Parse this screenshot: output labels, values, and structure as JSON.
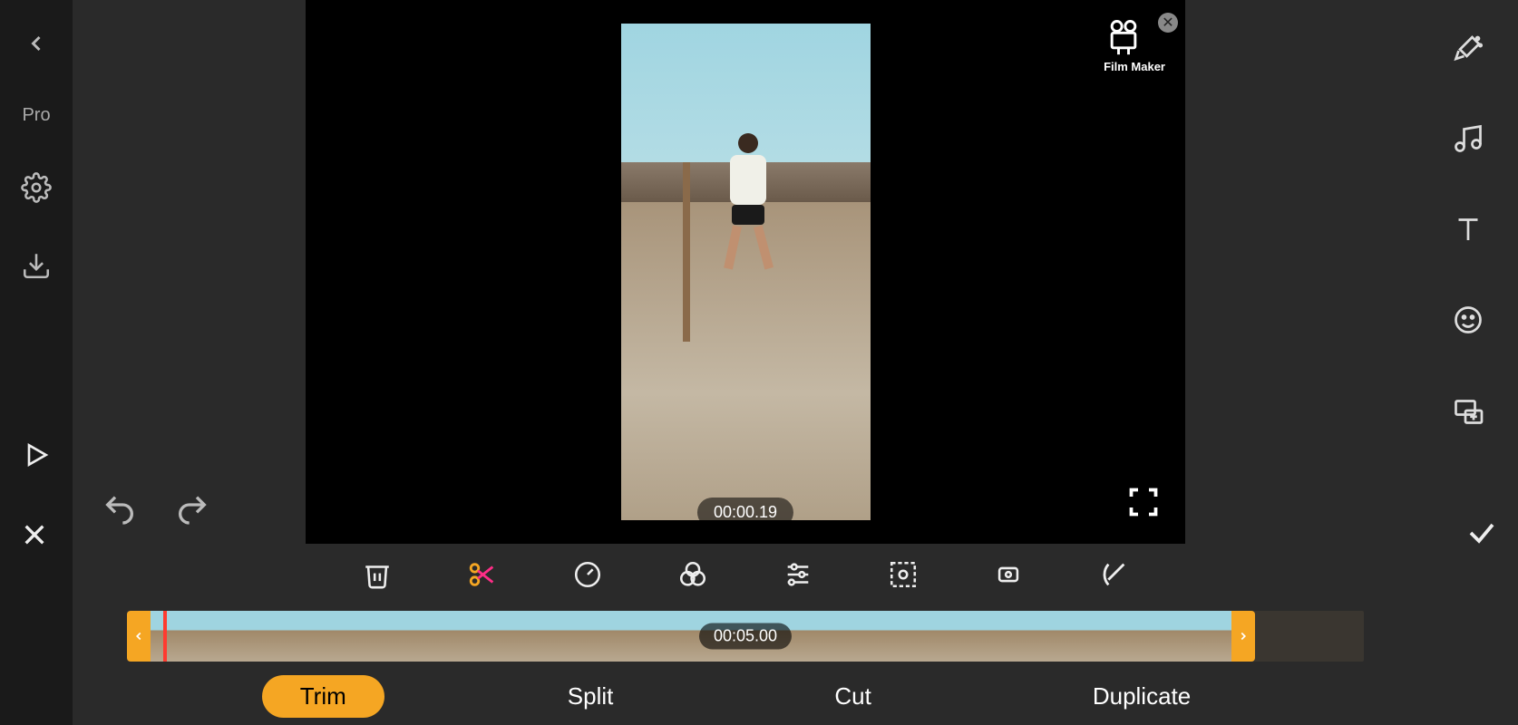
{
  "left_sidebar": {
    "pro_label": "Pro"
  },
  "preview": {
    "watermark_label": "Film Maker",
    "current_time": "00:00.19"
  },
  "timeline": {
    "duration": "00:05.00"
  },
  "tools": {
    "icons": [
      "delete",
      "scissors",
      "speed",
      "filter",
      "adjust",
      "crop-focus",
      "rotate-canvas",
      "flip"
    ]
  },
  "actions": {
    "trim": "Trim",
    "split": "Split",
    "cut": "Cut",
    "duplicate": "Duplicate",
    "active": "trim"
  },
  "right_sidebar": {
    "icons": [
      "effects",
      "music",
      "text",
      "sticker",
      "pip"
    ]
  }
}
